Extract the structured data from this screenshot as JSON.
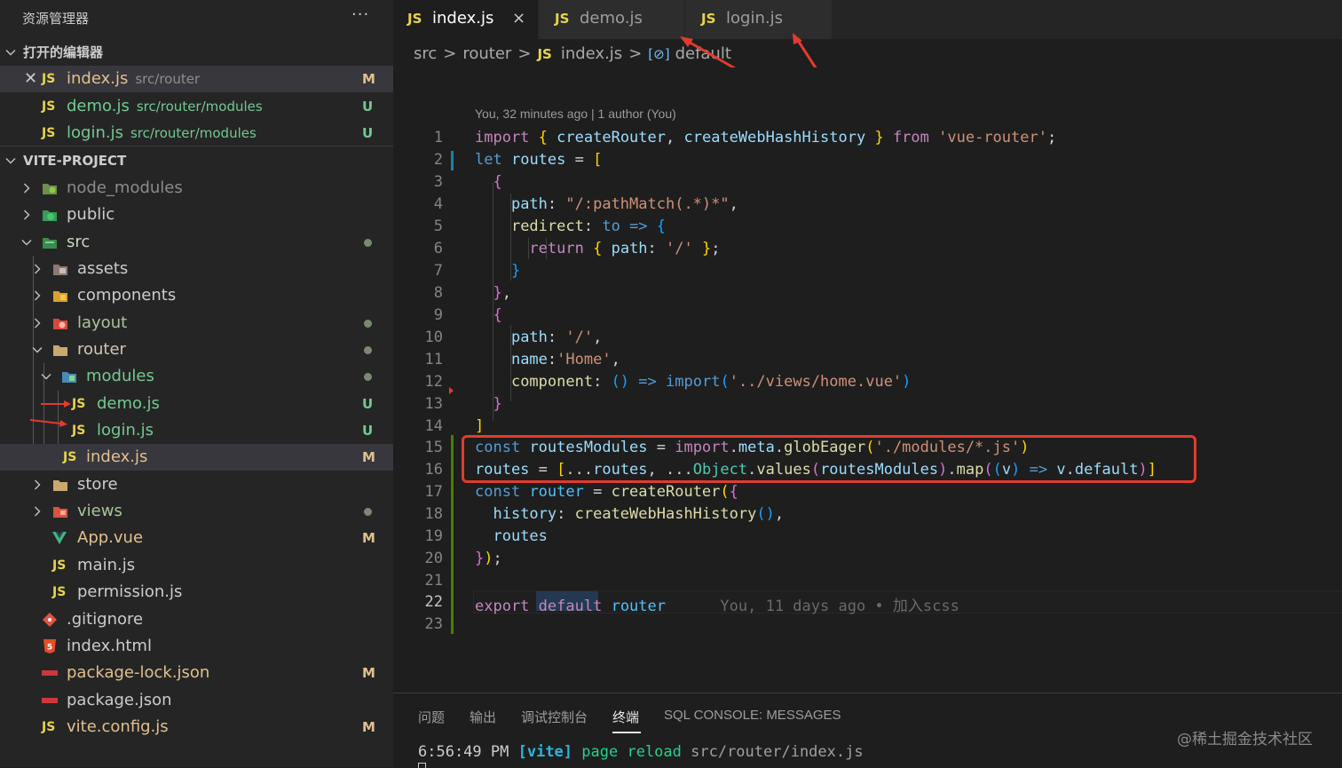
{
  "sidebar": {
    "title": "资源管理器",
    "more": "···",
    "open_editors": {
      "title": "打开的编辑器",
      "items": [
        {
          "name": "index.js",
          "path": "src/router",
          "status": "M"
        },
        {
          "name": "demo.js",
          "path": "src/router/modules",
          "status": "U"
        },
        {
          "name": "login.js",
          "path": "src/router/modules",
          "status": "U"
        }
      ]
    },
    "project": {
      "title": "VITE-PROJECT",
      "items": [
        {
          "name": "node_modules"
        },
        {
          "name": "public"
        },
        {
          "name": "src"
        },
        {
          "name": "assets"
        },
        {
          "name": "components"
        },
        {
          "name": "layout"
        },
        {
          "name": "router"
        },
        {
          "name": "modules"
        },
        {
          "name": "demo.js",
          "status": "U"
        },
        {
          "name": "login.js",
          "status": "U"
        },
        {
          "name": "index.js",
          "status": "M"
        },
        {
          "name": "store"
        },
        {
          "name": "views"
        },
        {
          "name": "App.vue",
          "status": "M"
        },
        {
          "name": "main.js"
        },
        {
          "name": "permission.js"
        },
        {
          "name": ".gitignore"
        },
        {
          "name": "index.html"
        },
        {
          "name": "package-lock.json",
          "status": "M"
        },
        {
          "name": "package.json"
        },
        {
          "name": "vite.config.js",
          "status": "M"
        }
      ]
    }
  },
  "tabs": [
    {
      "label": "index.js",
      "icon": "JS",
      "close": "×"
    },
    {
      "label": "demo.js",
      "icon": "JS"
    },
    {
      "label": "login.js",
      "icon": "JS"
    }
  ],
  "breadcrumb": [
    "src",
    "router",
    "index.js",
    "default"
  ],
  "breadcrumb_sep": ">",
  "editor": {
    "blame_header": "You, 32 minutes ago | 1 author (You)",
    "line_numbers": [
      "1",
      "2",
      "3",
      "4",
      "5",
      "6",
      "7",
      "8",
      "9",
      "10",
      "11",
      "12",
      "13",
      "14",
      "15",
      "16",
      "17",
      "18",
      "19",
      "20",
      "21",
      "22",
      "23"
    ],
    "inline_blame": "You, 11 days ago • 加入scss",
    "highlight_color": "#e23b2e"
  },
  "panel": {
    "tabs": [
      "问题",
      "输出",
      "调试控制台",
      "终端",
      "SQL CONSOLE: MESSAGES"
    ],
    "active_tab": "终端",
    "terminal": {
      "time": "6:56:49 PM",
      "tag": "[vite]",
      "action": "page reload",
      "file": "src/router/index.js"
    },
    "watermark": "@稀土掘金技术社区"
  },
  "colors": {
    "modified": "#e2c08d",
    "untracked": "#73c991",
    "js_icon": "#e8d44d",
    "annotation_red": "#e23b2e"
  }
}
